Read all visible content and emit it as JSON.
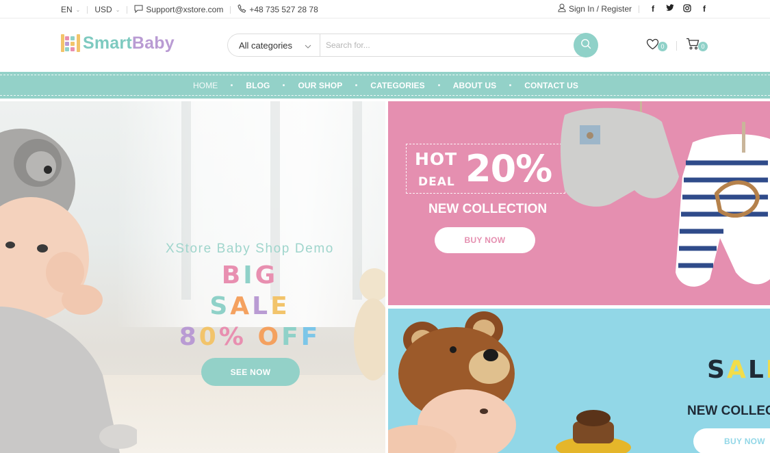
{
  "topbar": {
    "language": "EN",
    "currency": "USD",
    "email": "Support@xstore.com",
    "phone": "+48 735 527 28 78",
    "account": "Sign In / Register"
  },
  "header": {
    "logo_part1": "Smart",
    "logo_part2": "Baby",
    "category_select": "All categories",
    "search_placeholder": "Search for...",
    "wishlist_count": "0",
    "cart_count": "0"
  },
  "nav": {
    "items": [
      {
        "label": "HOME"
      },
      {
        "label": "BLOG"
      },
      {
        "label": "OUR SHOP"
      },
      {
        "label": "CATEGORIES"
      },
      {
        "label": "ABOUT US"
      },
      {
        "label": "CONTACT US"
      }
    ]
  },
  "hero": {
    "subtitle": "XStore Baby Shop Demo",
    "line1": "BIG",
    "line2": "SALE",
    "line3": "80% OFF",
    "button": "SEE NOW"
  },
  "promo_pink": {
    "hot": "HOT",
    "deal": "DEAL",
    "percent": "20%",
    "title": "NEW COLLECTION",
    "button": "BUY NOW"
  },
  "promo_blue": {
    "title": "SALE",
    "subtitle": "NEW COLLECTION",
    "button": "BUY NOW"
  },
  "colors": {
    "accent": "#93d1c8",
    "pink": "#e58fb0",
    "blue": "#92d7e7",
    "logo_purple": "#b99bd3"
  }
}
